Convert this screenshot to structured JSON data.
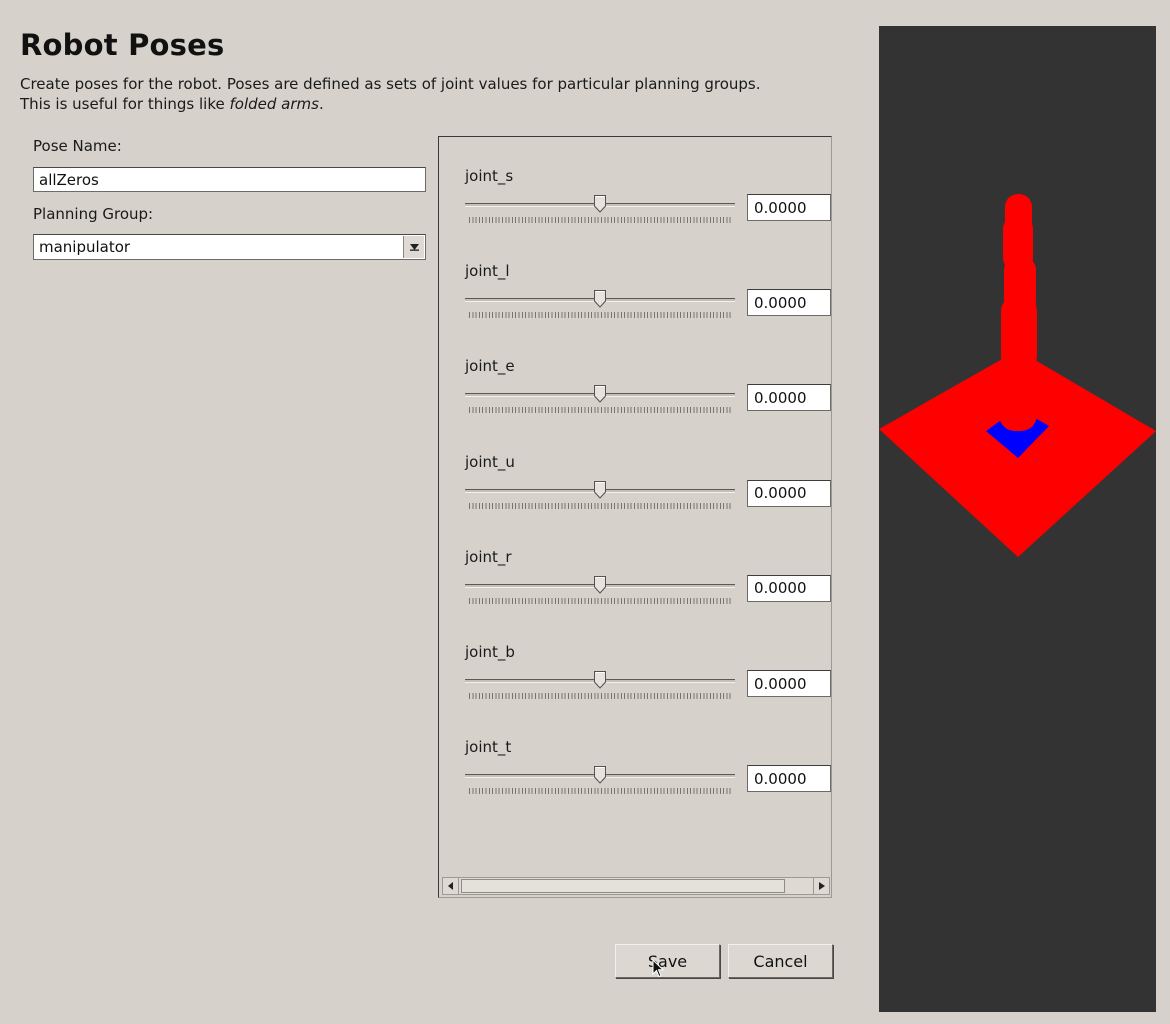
{
  "page": {
    "title": "Robot Poses",
    "description_line1": "Create poses for the robot. Poses are defined as sets of joint values for particular planning groups.",
    "description_line2_prefix": "This is useful for things like ",
    "description_line2_emphasis": "folded arms",
    "description_line2_suffix": "."
  },
  "form": {
    "pose_name_label": "Pose Name:",
    "pose_name_value": "allZeros",
    "planning_group_label": "Planning Group:",
    "planning_group_value": "manipulator"
  },
  "joints": [
    {
      "name": "joint_s",
      "value": "0.0000",
      "slider_fraction": 0.5
    },
    {
      "name": "joint_l",
      "value": "0.0000",
      "slider_fraction": 0.5
    },
    {
      "name": "joint_e",
      "value": "0.0000",
      "slider_fraction": 0.5
    },
    {
      "name": "joint_u",
      "value": "0.0000",
      "slider_fraction": 0.5
    },
    {
      "name": "joint_r",
      "value": "0.0000",
      "slider_fraction": 0.5
    },
    {
      "name": "joint_b",
      "value": "0.0000",
      "slider_fraction": 0.5
    },
    {
      "name": "joint_t",
      "value": "0.0000",
      "slider_fraction": 0.5
    }
  ],
  "buttons": {
    "save_label": "Save",
    "cancel_label": "Cancel"
  },
  "viewport": {
    "background": "#333333",
    "robot_color": "#ff0000",
    "base_color": "#0000ff"
  },
  "icons": {
    "combo_arrow": "chevron-down-icon",
    "scroll_left": "arrow-left-icon",
    "scroll_right": "arrow-right-icon",
    "cursor": "mouse-pointer-icon"
  }
}
